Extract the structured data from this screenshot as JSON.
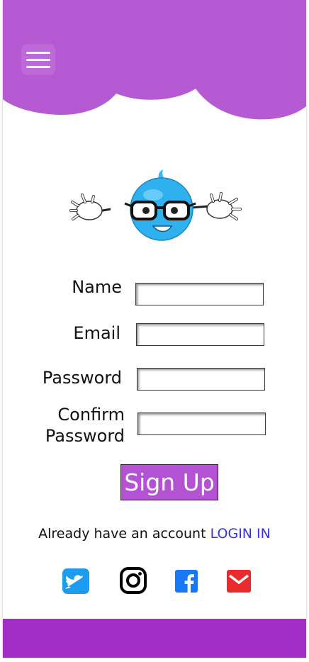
{
  "colors": {
    "header_purple": "#b55ad3",
    "footer_purple": "#a22dc7",
    "button_purple": "#b452d4",
    "link_blue": "#3c33d6",
    "twitter_blue": "#1d9bf0",
    "facebook_blue": "#1877f2",
    "mail_red": "#ea2b2b"
  },
  "header": {
    "menu_icon": "hamburger-menu-icon"
  },
  "mascot": {
    "icon": "blue-bird-mascot-with-glasses"
  },
  "form": {
    "name_label": "Name",
    "email_label": "Email",
    "password_label": "Password",
    "confirm_label_line1": "Confirm",
    "confirm_label_line2": "Password",
    "name_value": "",
    "email_value": "",
    "password_value": "",
    "confirm_value": "",
    "submit_label": "Sign Up"
  },
  "login": {
    "prompt": "Already have an account",
    "link": "LOGIN IN"
  },
  "social": [
    {
      "name": "twitter",
      "icon": "twitter-icon"
    },
    {
      "name": "instagram",
      "icon": "instagram-icon"
    },
    {
      "name": "facebook",
      "icon": "facebook-icon"
    },
    {
      "name": "mail",
      "icon": "mail-icon"
    }
  ]
}
